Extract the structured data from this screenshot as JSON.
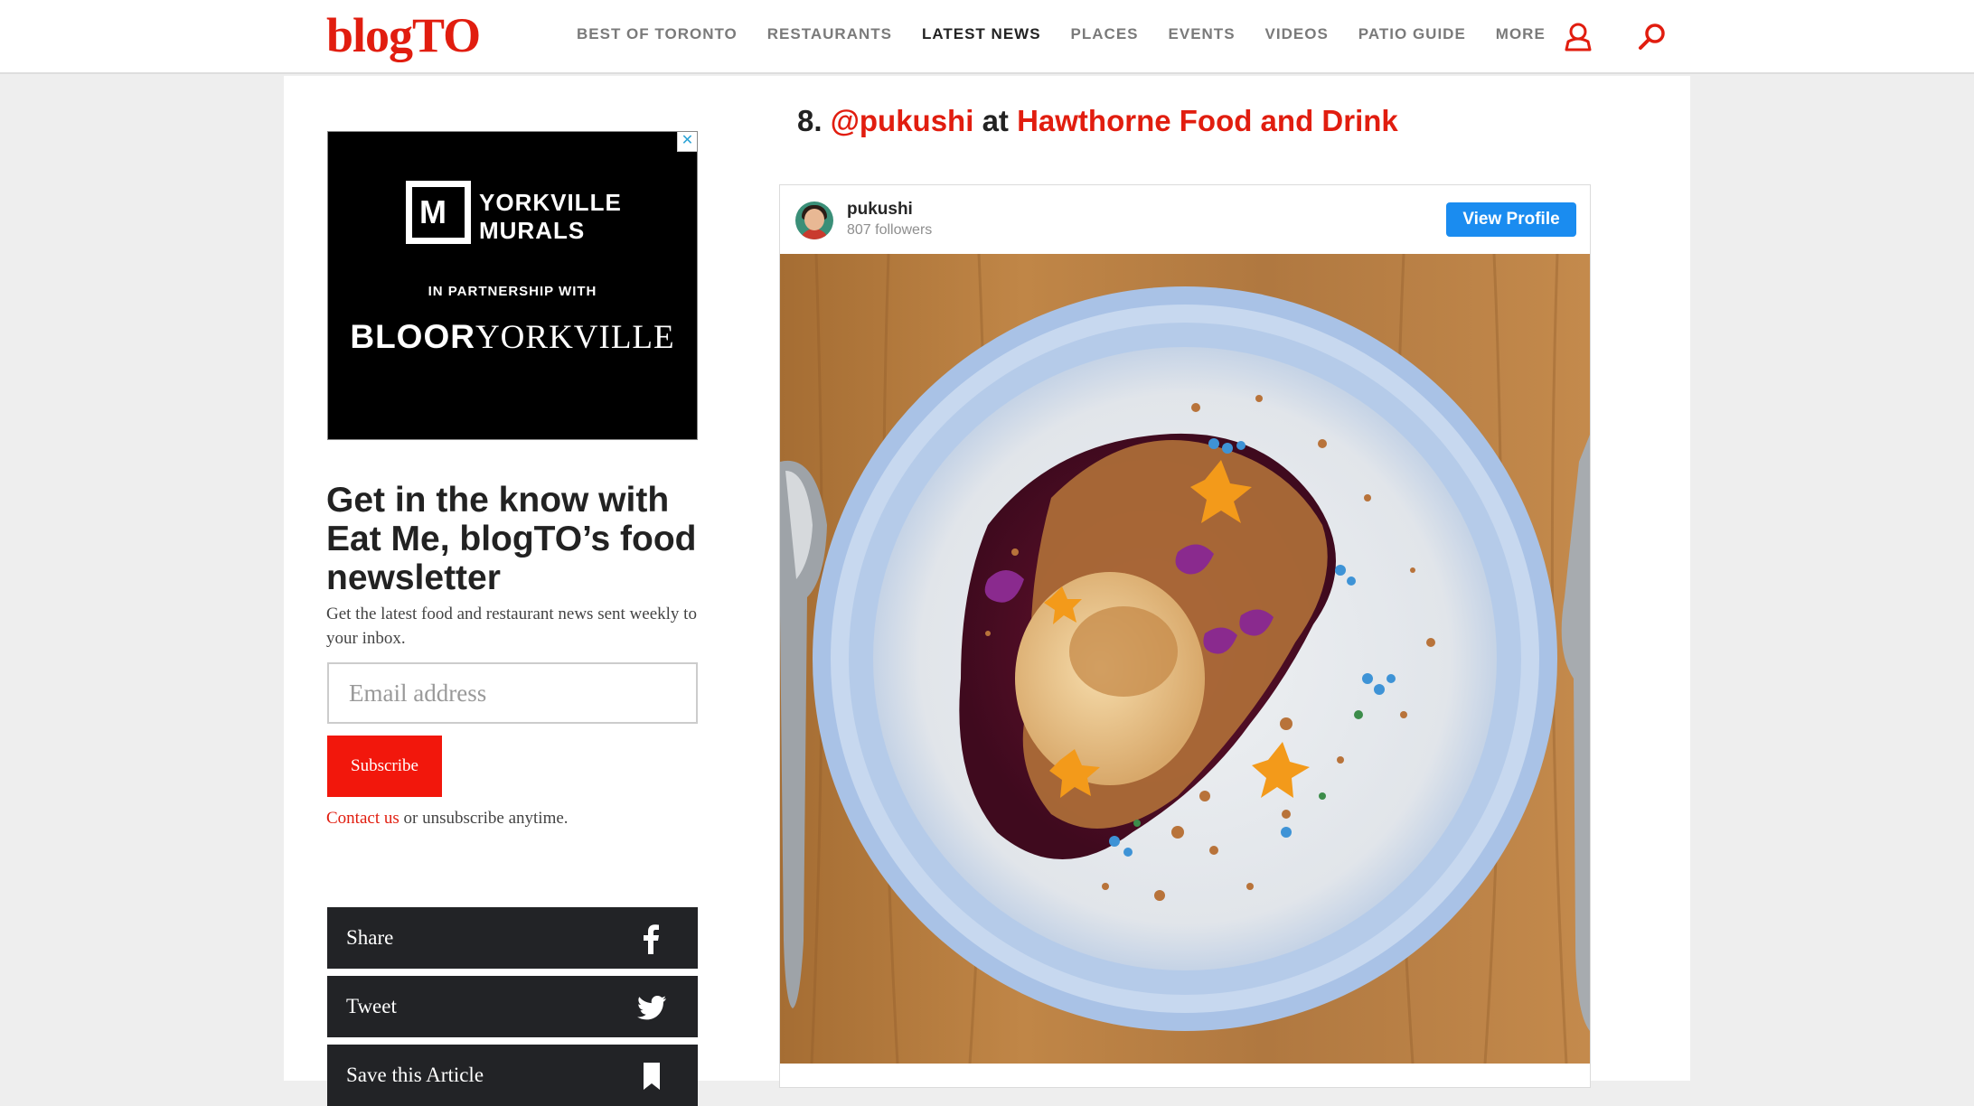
{
  "site": {
    "logo": "blogTO",
    "nav": [
      "BEST OF TORONTO",
      "RESTAURANTS",
      "LATEST NEWS",
      "PLACES",
      "EVENTS",
      "VIDEOS",
      "PATIO GUIDE",
      "MORE"
    ],
    "active_nav": "LATEST NEWS",
    "icons": [
      "user-icon",
      "search-icon"
    ],
    "accent_color": "#e11d0f"
  },
  "ad": {
    "close": "✕",
    "brand_line1": "YORKVILLE",
    "brand_line2": "MURALS",
    "partner": "IN PARTNERSHIP WITH",
    "bloor": "BLOOR",
    "yorkville": "YORKVILLE"
  },
  "newsletter": {
    "title": "Get in the know with Eat Me, blogTO’s food newsletter",
    "description": "Get the latest food and restaurant news sent weekly to your inbox.",
    "email_placeholder": "Email address",
    "subscribe_label": "Subscribe",
    "contact_link": "Contact us",
    "footer_rest": " or unsubscribe anytime."
  },
  "social": {
    "share": "Share",
    "tweet": "Tweet",
    "save": "Save this Article"
  },
  "article": {
    "number": "8.",
    "handle": "@pukushi",
    "at": "at",
    "place": "Hawthorne Food and Drink"
  },
  "instagram": {
    "username": "pukushi",
    "followers": "807 followers",
    "view_profile": "View Profile",
    "button_color": "#1a8cf0"
  }
}
